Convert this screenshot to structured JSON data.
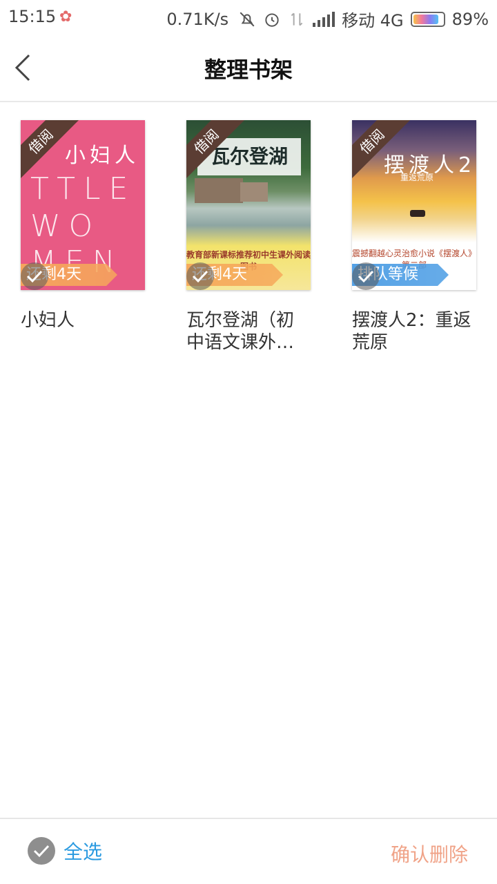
{
  "status_bar": {
    "time": "15:15",
    "speed": "0.71K/s",
    "carrier": "移动 4G",
    "battery": "89%"
  },
  "header": {
    "title": "整理书架"
  },
  "books": [
    {
      "title": "小妇人",
      "ribbon": "借阅",
      "tag": "还剩4天",
      "cover_title": "小妇人",
      "cover_letters_1": "TTLE",
      "cover_letters_2": "WO",
      "cover_letters_3": "MEN"
    },
    {
      "title": "瓦尔登湖（初中语文课外…",
      "ribbon": "借阅",
      "tag": "还剩4天",
      "cover_title": "瓦尔登湖",
      "cover_footer": "教育部新课标推荐初中生课外阅读图书"
    },
    {
      "title": "摆渡人2：重返荒原",
      "ribbon": "借阅",
      "tag": "排队等候",
      "cover_title": "摆渡人2",
      "cover_subtitle": "重返荒原",
      "cover_footer": "震撼翻越心灵治愈小说《摆渡人》第二部"
    }
  ],
  "bottom_bar": {
    "select_all": "全选",
    "confirm_delete": "确认删除"
  },
  "colors": {
    "accent_blue": "#2a9ae0",
    "delete_orange": "#f0a388",
    "ribbon_brown": "#5b3d33"
  }
}
